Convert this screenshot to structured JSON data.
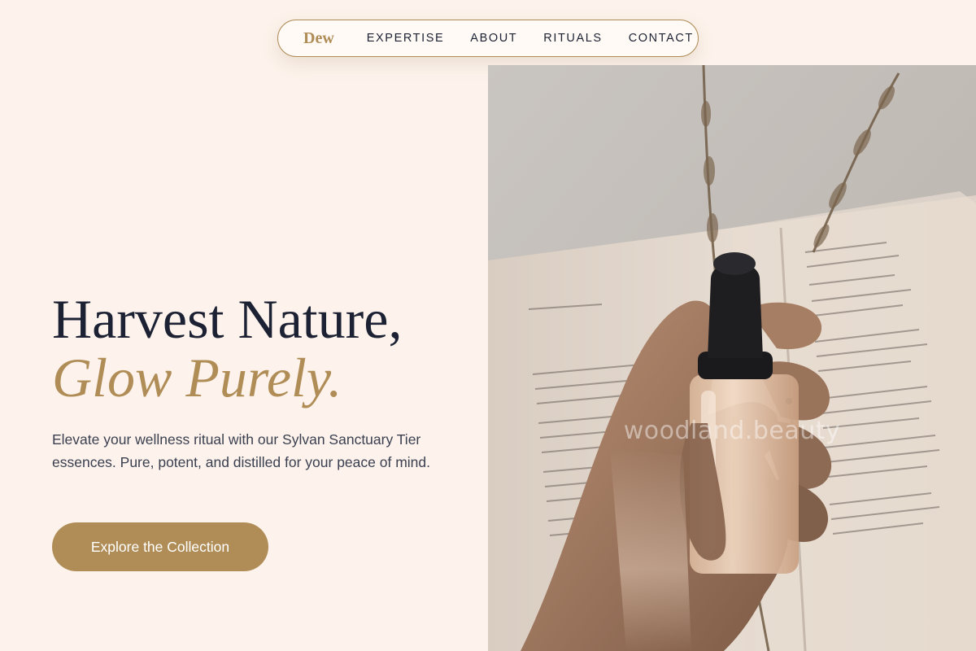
{
  "nav": {
    "brand": "Dew",
    "links": [
      "EXPERTISE",
      "ABOUT",
      "RITUALS",
      "CONTACT"
    ]
  },
  "hero": {
    "title_line1": "Harvest Nature,",
    "title_line2": "Glow Purely.",
    "description": "Elevate your wellness ritual with our Sylvan Sanctuary Tier essences. Pure, potent, and distilled for your peace of mind.",
    "cta_label": "Explore the Collection",
    "image_watermark": "woodland.beauty"
  },
  "colors": {
    "background": "#fdf3ec",
    "accent": "#b08d57",
    "text": "#1c2233"
  }
}
